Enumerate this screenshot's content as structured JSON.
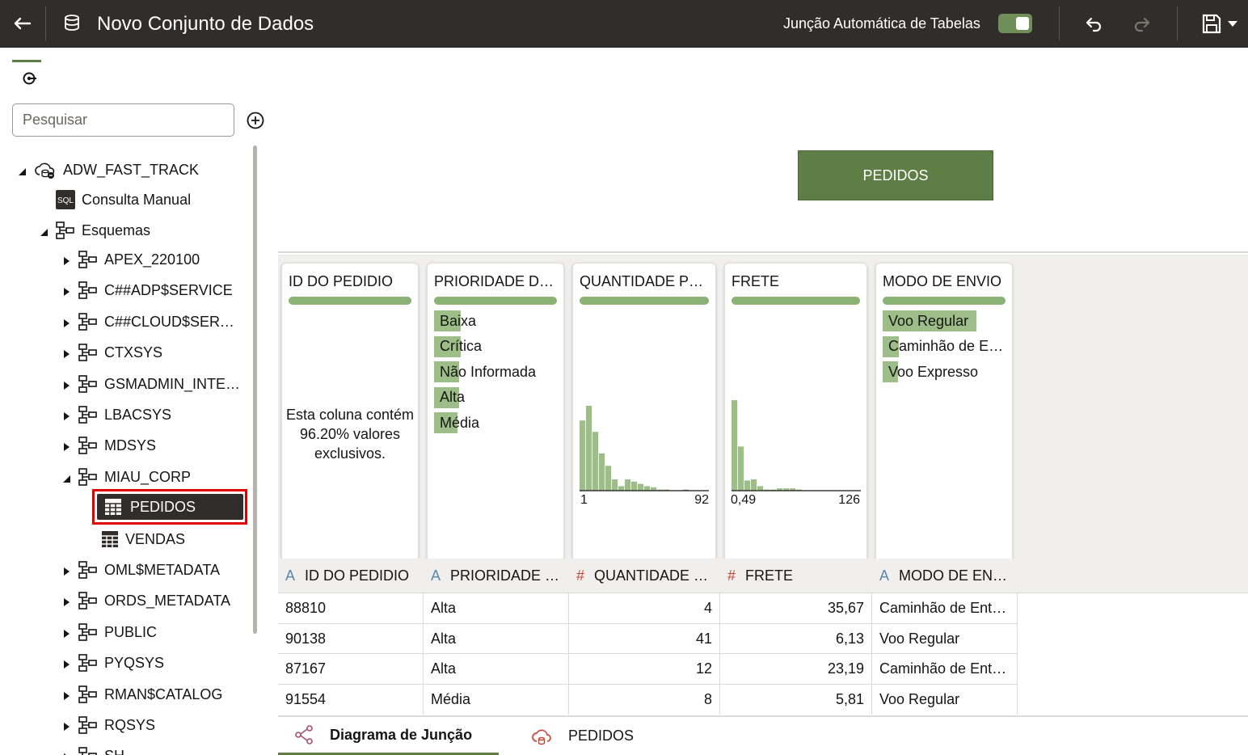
{
  "topbar": {
    "back_icon": "arrow-left-icon",
    "title": "Novo Conjunto de Dados",
    "auto_join_label": "Junção Automática de Tabelas",
    "auto_join_enabled": true
  },
  "sidebar": {
    "search_placeholder": "Pesquisar",
    "tree": {
      "connection": "ADW_FAST_TRACK",
      "manual_query": "Consulta Manual",
      "schemas_label": "Esquemas",
      "schemas_before": [
        "APEX_220100",
        "C##ADP$SERVICE",
        "C##CLOUD$SERVICE",
        "CTXSYS",
        "GSMADMIN_INTERNAL",
        "LBACSYS",
        "MDSYS"
      ],
      "expanded_schema": "MIAU_CORP",
      "tables": [
        "PEDIDOS",
        "VENDAS"
      ],
      "selected_table": "PEDIDOS",
      "schemas_after": [
        "OML$METADATA",
        "ORDS_METADATA",
        "PUBLIC",
        "PYQSYS",
        "RMAN$CATALOG",
        "RQSYS",
        "SH"
      ]
    }
  },
  "diagram": {
    "node_label": "PEDIDOS"
  },
  "profile": {
    "cards": [
      {
        "title": "ID DO PEDIDIO",
        "note": "Esta coluna contém 96.20% valores exclusivos."
      },
      {
        "title": "PRIORIDADE DO PEDIDO",
        "categories": [
          {
            "label": "Baixa",
            "share": 0.21
          },
          {
            "label": "Crítica",
            "share": 0.21
          },
          {
            "label": "Não Informada",
            "share": 0.2
          },
          {
            "label": "Alta",
            "share": 0.2
          },
          {
            "label": "Média",
            "share": 0.19
          }
        ]
      },
      {
        "title": "QUANTIDADE PEDIDA",
        "axis_min": "1",
        "axis_max": "92",
        "bins": [
          0.62,
          0.75,
          0.52,
          0.33,
          0.22,
          0.1,
          0.04,
          0.1,
          0.08,
          0.06,
          0.04,
          0.03,
          0.01,
          0.01,
          0.0,
          0.0,
          0.01,
          0.0,
          0.0,
          0.0
        ]
      },
      {
        "title": "FRETE",
        "axis_min": "0,49",
        "axis_max": "126",
        "bins": [
          0.8,
          0.39,
          0.09,
          0.1,
          0.04,
          0.01,
          0.01,
          0.02,
          0.02,
          0.02,
          0.01,
          0.0,
          0.0,
          0.0,
          0.0,
          0.0,
          0.0,
          0.0,
          0.0,
          0.0
        ]
      },
      {
        "title": "MODO DE ENVIO",
        "categories": [
          {
            "label": "Voo Regular",
            "share": 0.75
          },
          {
            "label": "Caminhão de Entrega",
            "share": 0.13
          },
          {
            "label": "Voo Expresso",
            "share": 0.12
          }
        ]
      }
    ]
  },
  "grid": {
    "columns": [
      {
        "type": "A",
        "name": "ID DO PEDIDIO"
      },
      {
        "type": "A",
        "name": "PRIORIDADE DO PEDIDO"
      },
      {
        "type": "#",
        "name": "QUANTIDADE PEDIDA"
      },
      {
        "type": "#",
        "name": "FRETE"
      },
      {
        "type": "A",
        "name": "MODO DE ENVIO"
      }
    ],
    "rows": [
      [
        "88810",
        "Alta",
        "4",
        "35,67",
        "Caminhão de Entrega"
      ],
      [
        "90138",
        "Alta",
        "41",
        "6,13",
        "Voo Regular"
      ],
      [
        "87167",
        "Alta",
        "12",
        "23,19",
        "Caminhão de Entrega"
      ],
      [
        "91554",
        "Média",
        "8",
        "5,81",
        "Voo Regular"
      ]
    ]
  },
  "bottom_tabs": {
    "join_diagram": "Diagrama de Junção",
    "pedidos": "PEDIDOS"
  },
  "colors": {
    "topbar": "#312d2a",
    "accent_green": "#5e7e46",
    "bar_green": "#8ab274",
    "highlight_red": "#e00000"
  }
}
